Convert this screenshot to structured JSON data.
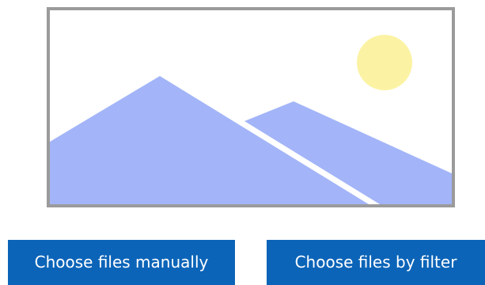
{
  "buttons": {
    "manual_label": "Choose files manually",
    "filter_label": "Choose files by filter"
  },
  "colors": {
    "button_bg": "#0b64b8",
    "button_text": "#ffffff",
    "frame_border": "#9b9b9b",
    "mountain_fill": "#a3b5f8",
    "sun_fill": "#fbf3a3"
  },
  "image_placeholder": {
    "icon": "image-placeholder-icon"
  }
}
